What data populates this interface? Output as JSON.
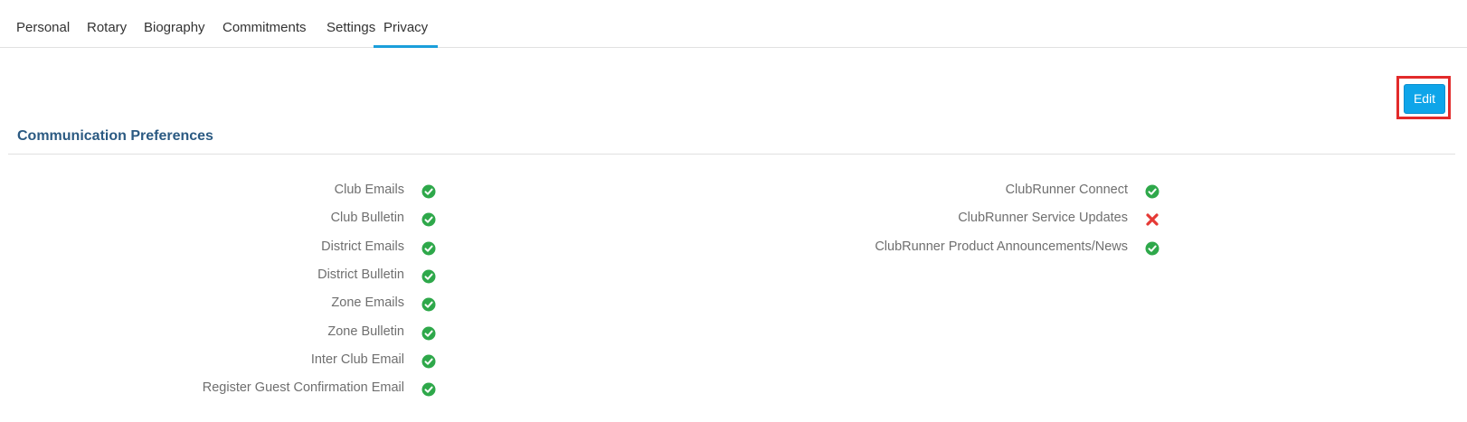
{
  "tabs": [
    {
      "label": "Personal",
      "active": false
    },
    {
      "label": "Rotary",
      "active": false
    },
    {
      "label": "Biography",
      "active": false
    },
    {
      "label": "Commitments",
      "active": false
    },
    {
      "label": "Settings",
      "active": false
    },
    {
      "label": "Privacy",
      "active": true
    }
  ],
  "toolbar": {
    "edit_label": "Edit"
  },
  "section": {
    "title": "Communication Preferences"
  },
  "preferences_left": [
    {
      "label": "Club Emails",
      "status": "enabled",
      "icon": "check-circle-icon"
    },
    {
      "label": "Club Bulletin",
      "status": "enabled",
      "icon": "check-circle-icon"
    },
    {
      "label": "District Emails",
      "status": "enabled",
      "icon": "check-circle-icon"
    },
    {
      "label": "District Bulletin",
      "status": "enabled",
      "icon": "check-circle-icon"
    },
    {
      "label": "Zone Emails",
      "status": "enabled",
      "icon": "check-circle-icon"
    },
    {
      "label": "Zone Bulletin",
      "status": "enabled",
      "icon": "check-circle-icon"
    },
    {
      "label": "Inter Club Email",
      "status": "enabled",
      "icon": "check-circle-icon"
    },
    {
      "label": "Register Guest Confirmation Email",
      "status": "enabled",
      "icon": "check-circle-icon"
    }
  ],
  "preferences_right": [
    {
      "label": "ClubRunner Connect",
      "status": "enabled",
      "icon": "check-circle-icon"
    },
    {
      "label": "ClubRunner Service Updates",
      "status": "disabled",
      "icon": "x-mark-icon"
    },
    {
      "label": "ClubRunner Product Announcements/News",
      "status": "enabled",
      "icon": "check-circle-icon"
    }
  ],
  "colors": {
    "accent": "#1a9fdb",
    "enabled": "#2ea84a",
    "disabled": "#e53935",
    "title": "#2b5a82",
    "highlight": "#e22a2a"
  }
}
